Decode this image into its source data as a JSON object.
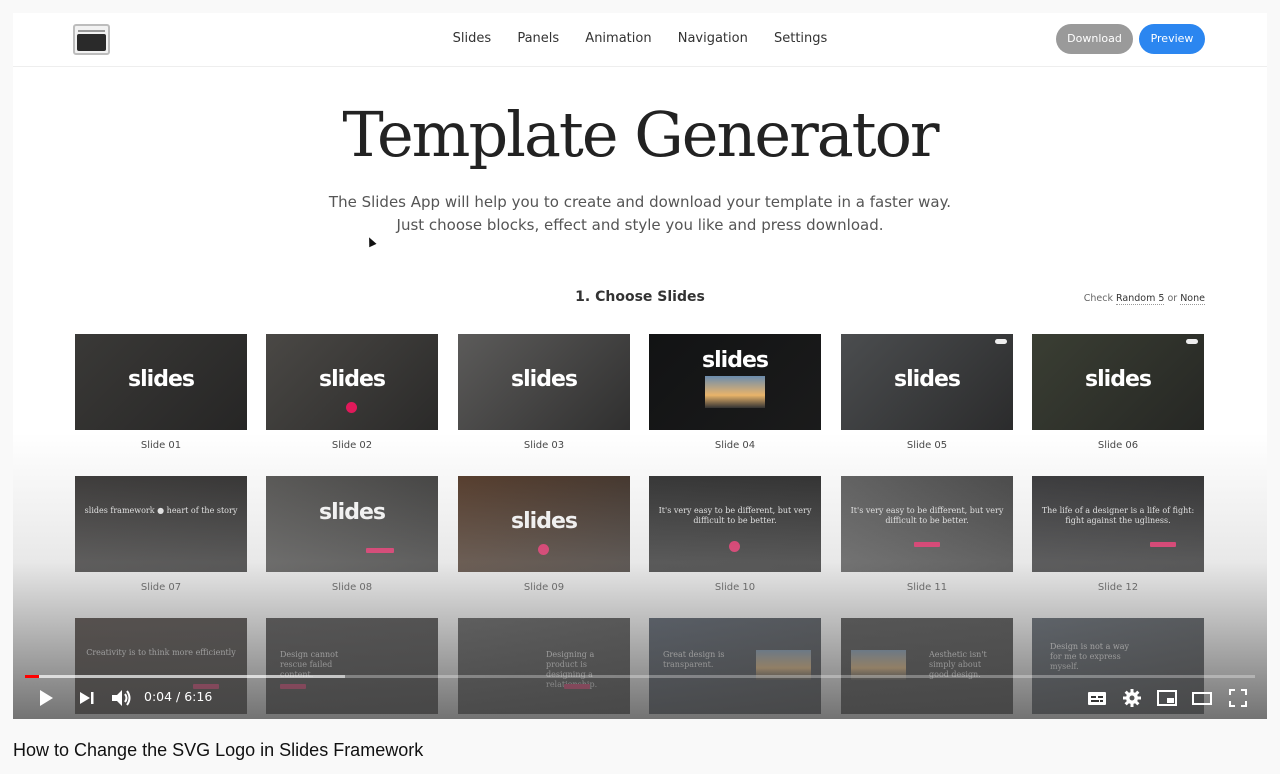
{
  "app": {
    "nav": [
      "Slides",
      "Panels",
      "Animation",
      "Navigation",
      "Settings"
    ],
    "buttons": {
      "download": "Download",
      "preview": "Preview"
    },
    "colors": {
      "preview": "#2b86f0",
      "download": "#9a9a9a",
      "accent_pink": "#e0195a"
    }
  },
  "hero": {
    "title": "Template Generator",
    "subtitle_line1": "The Slides App will help you to create and download your template in a faster way.",
    "subtitle_line2": "Just choose blocks, effect and style you like and press download."
  },
  "section": {
    "title": "1. Choose Slides",
    "check_prefix": "Check",
    "check_random": "Random 5",
    "check_or": "or",
    "check_none": "None"
  },
  "slides": [
    {
      "label": "Slide 01",
      "kind": "logo",
      "bg": "#3a3937"
    },
    {
      "label": "Slide 02",
      "kind": "logo-play",
      "bg": "#4a4845"
    },
    {
      "label": "Slide 03",
      "kind": "logo",
      "bg": "#5c5b5a"
    },
    {
      "label": "Slide 04",
      "kind": "logo-inset",
      "bg": "#121314"
    },
    {
      "label": "Slide 05",
      "kind": "logo-nav",
      "bg": "#4b4d4f"
    },
    {
      "label": "Slide 06",
      "kind": "logo-nav",
      "bg": "#3a3e33"
    },
    {
      "label": "Slide 07",
      "kind": "text",
      "text": "slides framework  ●  heart of the story",
      "bg": "#2e2c2b"
    },
    {
      "label": "Slide 08",
      "kind": "logo-form",
      "bg": "#4d4c4a"
    },
    {
      "label": "Slide 09",
      "kind": "logo-play",
      "bg": "#4a2e1c"
    },
    {
      "label": "Slide 10",
      "kind": "quote-play",
      "text": "It's very easy to be different, but very difficult to be better.",
      "bg": "#262626"
    },
    {
      "label": "Slide 11",
      "kind": "quote-btn",
      "text": "It's very easy to be different, but very difficult to be better.",
      "bg": "#575757"
    },
    {
      "label": "Slide 12",
      "kind": "quote-form",
      "text": "The life of a designer is a life of fight: fight against the ugliness.",
      "bg": "#2c2c2e"
    },
    {
      "label": "",
      "kind": "quote-form",
      "text": "Creativity is to think more efficiently",
      "bg": "#2a1f1a"
    },
    {
      "label": "",
      "kind": "quote-btn-left",
      "text": "Design cannot rescue failed content.",
      "bg": "#2a2828"
    },
    {
      "label": "",
      "kind": "quote-btn-right",
      "text": "Designing a product is designing a relationship.",
      "bg": "#3b3b3b"
    },
    {
      "label": "",
      "kind": "quote-inset",
      "text": "Great design is transparent.",
      "bg": "#2f3a4a"
    },
    {
      "label": "",
      "kind": "quote-inset-right",
      "text": "Aesthetic isn't simply about good design.",
      "bg": "#2a2a2a"
    },
    {
      "label": "",
      "kind": "quote-left",
      "text": "Design is not a way for me to express myself.",
      "bg": "#3a4450"
    }
  ],
  "player": {
    "current_time": "0:04",
    "duration": "6:16",
    "time_display": "0:04 / 6:16",
    "played_fraction": 0.011,
    "buffered_fraction": 0.26
  },
  "video_title": "How to Change the SVG Logo in Slides Framework"
}
